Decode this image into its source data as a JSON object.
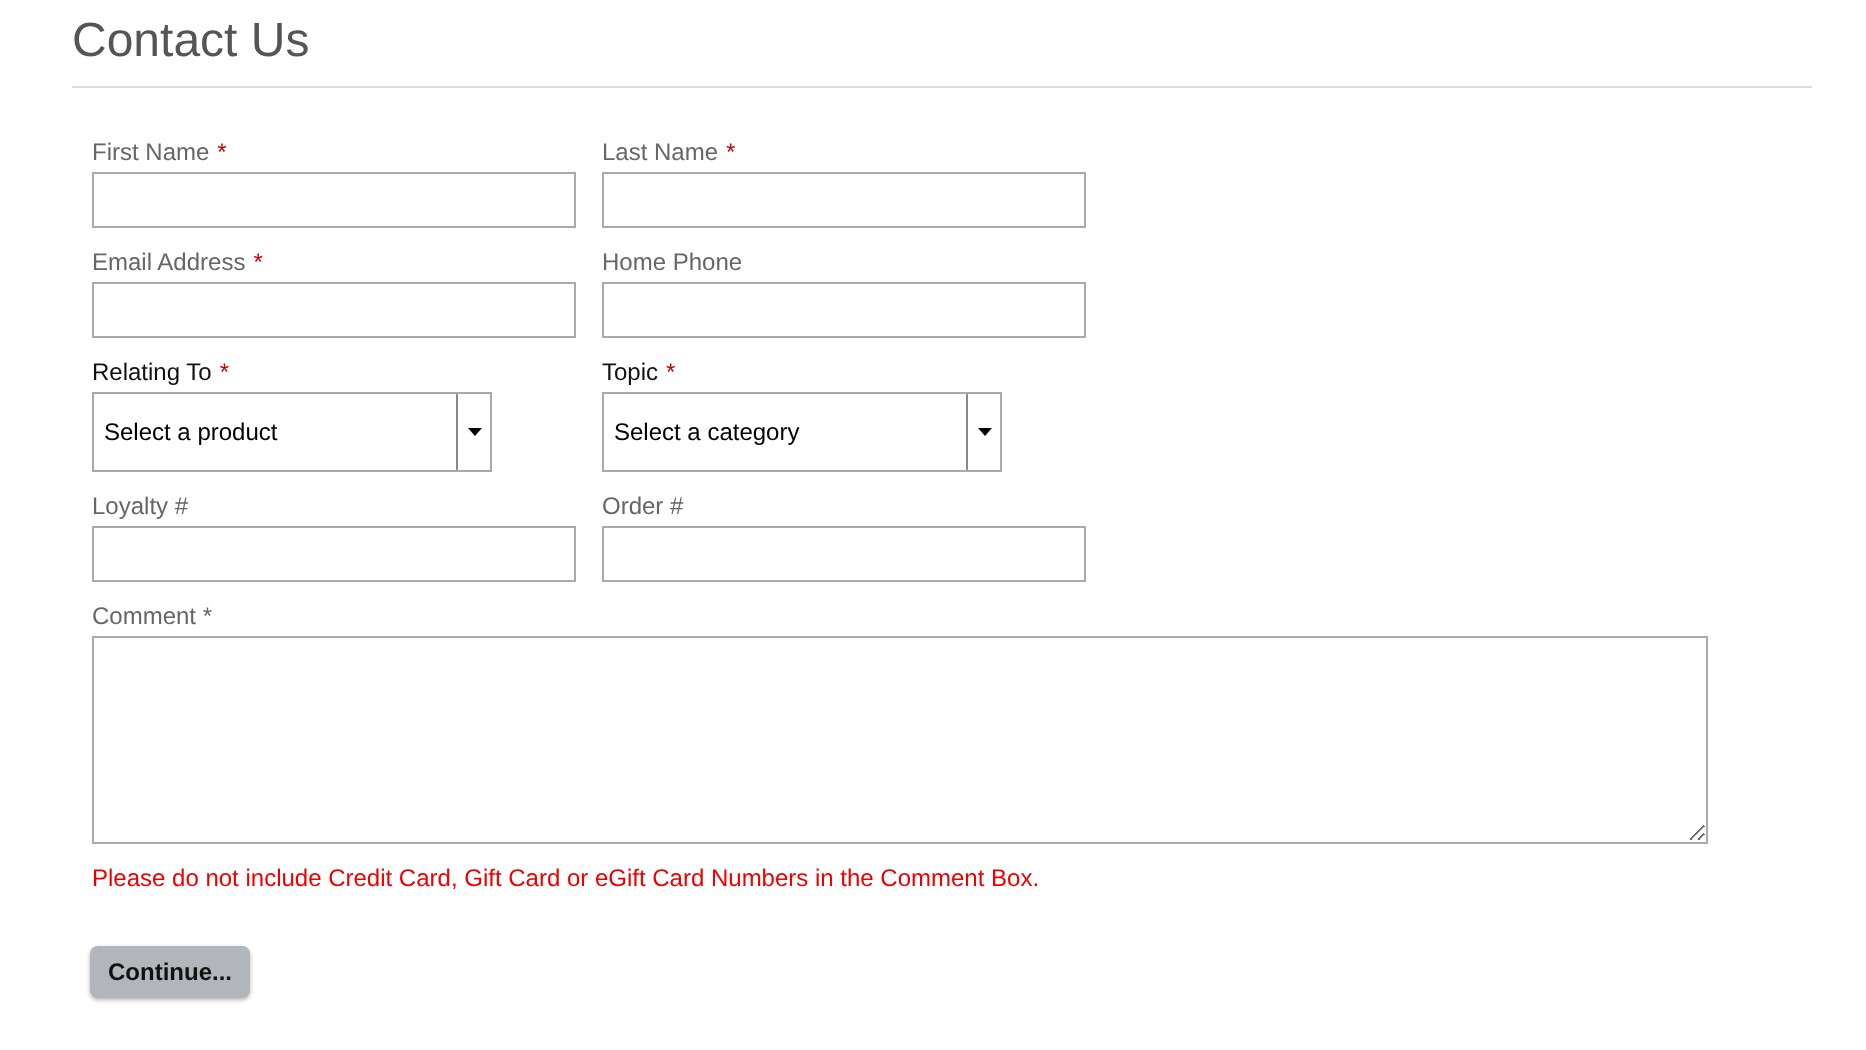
{
  "title": "Contact Us",
  "fields": [
    {
      "kind": "text",
      "label": "First Name",
      "mark": "*"
    },
    {
      "kind": "text",
      "label": "Last Name",
      "mark": "*"
    },
    {
      "kind": "text",
      "label": "Email Address",
      "mark": "*"
    },
    {
      "kind": "text",
      "label": "Home Phone"
    },
    {
      "kind": "select",
      "label": "Relating To",
      "mark": "*",
      "value": "Select a product"
    },
    {
      "kind": "select",
      "label": "Topic",
      "mark": "*",
      "value": "Select a category"
    },
    {
      "kind": "text",
      "label": "Loyalty #"
    },
    {
      "kind": "text",
      "label": "Order #"
    }
  ],
  "comment": {
    "label": "Comment *"
  },
  "warning": "Please do not include Credit Card, Gift Card or eGift Card Numbers in the Comment Box.",
  "button": "Continue..."
}
